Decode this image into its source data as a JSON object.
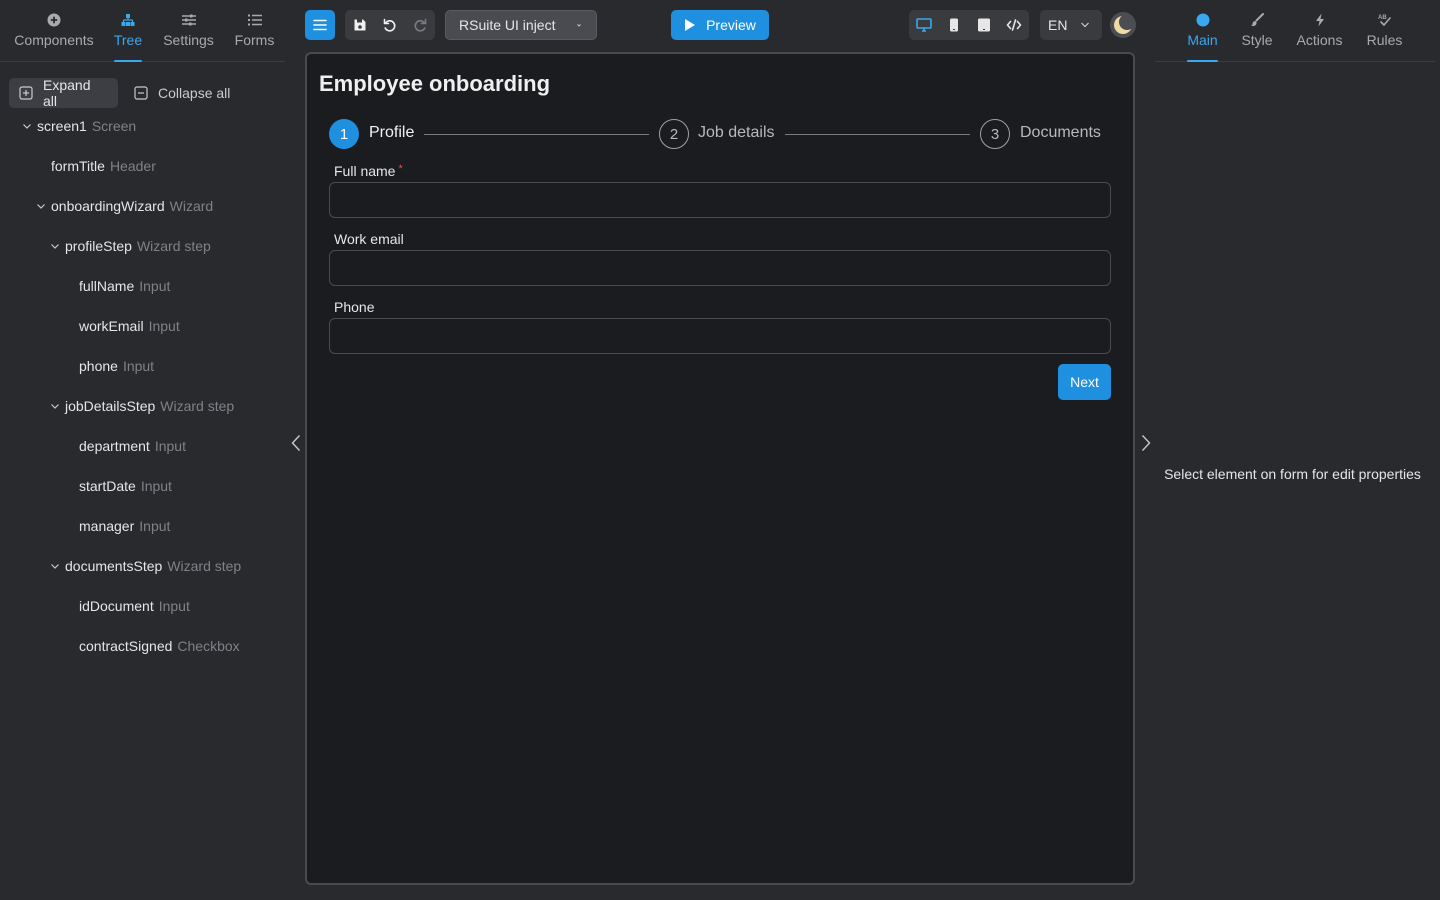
{
  "left_tabs": [
    {
      "label": "Components",
      "icon": "plus-circle-icon"
    },
    {
      "label": "Tree",
      "icon": "tree-icon",
      "active": true
    },
    {
      "label": "Settings",
      "icon": "sliders-icon"
    },
    {
      "label": "Forms",
      "icon": "list-icon"
    }
  ],
  "tree_actions": {
    "expand_all": "Expand all",
    "collapse_all": "Collapse all"
  },
  "tree": [
    {
      "name": "screen1",
      "type": "Screen"
    },
    {
      "name": "formTitle",
      "type": "Header"
    },
    {
      "name": "onboardingWizard",
      "type": "Wizard"
    },
    {
      "name": "profileStep",
      "type": "Wizard step"
    },
    {
      "name": "fullName",
      "type": "Input"
    },
    {
      "name": "workEmail",
      "type": "Input"
    },
    {
      "name": "phone",
      "type": "Input"
    },
    {
      "name": "jobDetailsStep",
      "type": "Wizard step"
    },
    {
      "name": "department",
      "type": "Input"
    },
    {
      "name": "startDate",
      "type": "Input"
    },
    {
      "name": "manager",
      "type": "Input"
    },
    {
      "name": "documentsStep",
      "type": "Wizard step"
    },
    {
      "name": "idDocument",
      "type": "Input"
    },
    {
      "name": "contractSigned",
      "type": "Checkbox"
    }
  ],
  "toolbar": {
    "theme_select": "RSuite UI inject",
    "preview": "Preview",
    "language": "EN"
  },
  "form": {
    "title": "Employee onboarding",
    "steps": [
      {
        "number": "1",
        "label": "Profile",
        "active": true
      },
      {
        "number": "2",
        "label": "Job details"
      },
      {
        "number": "3",
        "label": "Documents"
      }
    ],
    "fields": [
      {
        "label": "Full name",
        "required_mark": "*",
        "value": ""
      },
      {
        "label": "Work email",
        "value": ""
      },
      {
        "label": "Phone",
        "value": ""
      }
    ],
    "next": "Next"
  },
  "right_tabs": [
    {
      "label": "Main",
      "icon": "dot-icon",
      "active": true
    },
    {
      "label": "Style",
      "icon": "brush-icon"
    },
    {
      "label": "Actions",
      "icon": "lightning-icon"
    },
    {
      "label": "Rules",
      "icon": "rules-check-icon"
    }
  ],
  "right_hint": "Select element on form for edit properties",
  "colors": {
    "accent": "#1f8fe0",
    "tab_active": "#3aa8ee",
    "background": "#292a2e",
    "canvas": "#1b1c20",
    "required": "#e05050"
  }
}
